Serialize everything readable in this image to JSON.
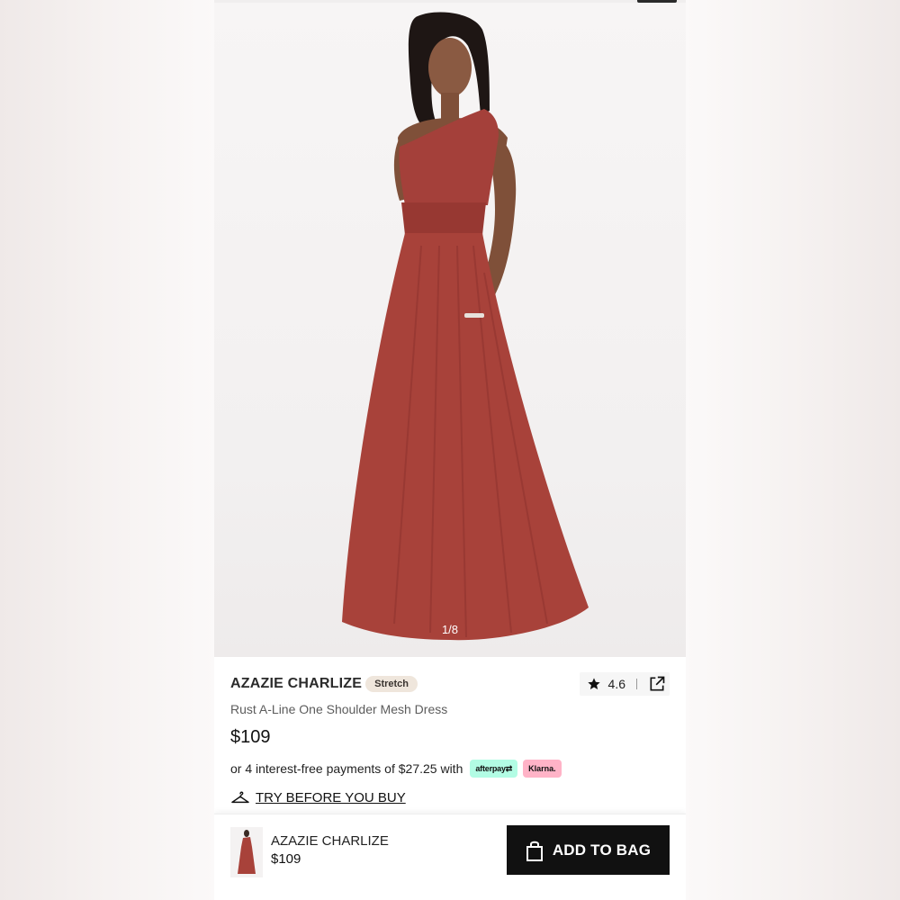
{
  "product": {
    "brand": "AZAZIE CHARLIZE",
    "badge": "Stretch",
    "subtitle": "Rust A-Line One Shoulder Mesh Dress",
    "price": "$109",
    "rating": "4.6",
    "image_counter": "1/8",
    "dress_color": "#a8423a"
  },
  "payments": {
    "text": "or 4 interest-free payments of $27.25 with",
    "afterpay_label": "afterpay",
    "klarna_label": "Klarna.",
    "afterpay_color": "#b2fce4",
    "klarna_color": "#ffb3c7"
  },
  "try_before": {
    "label": "TRY BEFORE YOU BUY",
    "icon": "hanger-icon"
  },
  "sticky_bar": {
    "name": "AZAZIE CHARLIZE",
    "price": "$109",
    "button_label": "ADD TO BAG",
    "button_icon": "shopping-bag-icon"
  },
  "icons": {
    "rating": "star-icon",
    "share": "external-link-icon"
  }
}
